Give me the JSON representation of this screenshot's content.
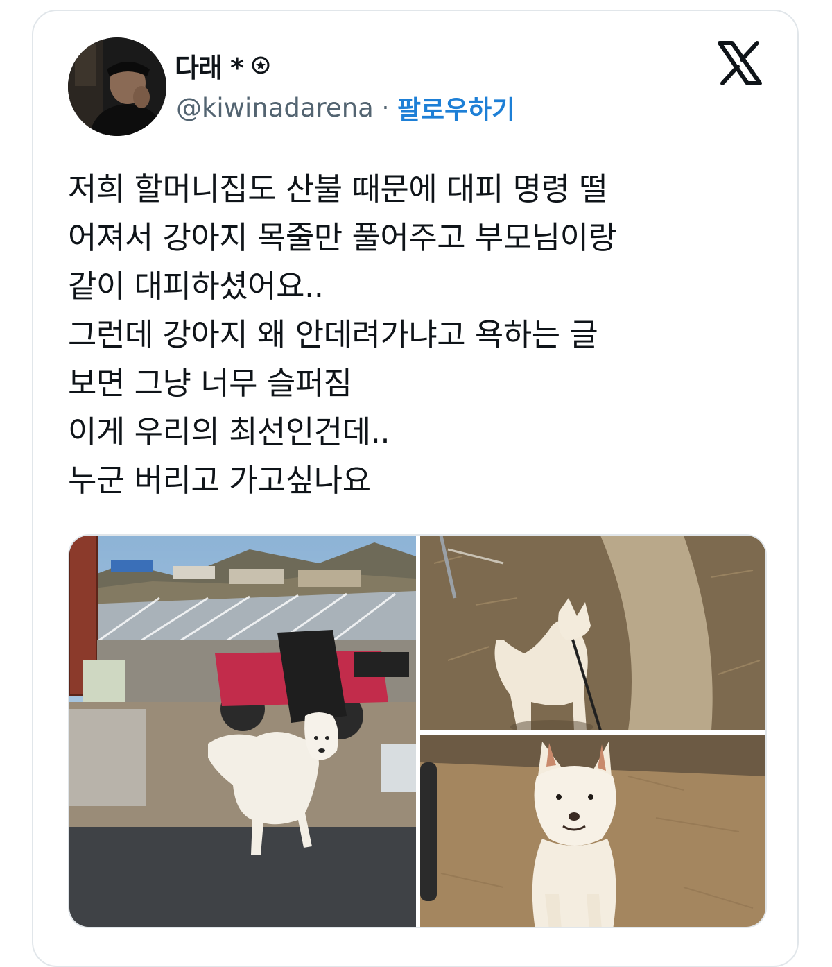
{
  "author": {
    "display_name": "다래 *",
    "badge_icon": "star-badge-icon",
    "handle": "@kiwinadarena",
    "separator": "·",
    "follow_label": "팔로우하기"
  },
  "platform_logo": "x-logo-icon",
  "tweet": {
    "lines": [
      "저희 할머니집도 산불 때문에 대피 명령 떨",
      "어져서 강아지 목줄만 풀어주고 부모님이랑",
      "같이 대피하셨어요..",
      "그런데 강아지 왜 안데려가냐고 욕하는 글",
      "보면 그냥 너무 슬퍼짐",
      "이게 우리의 최선인건데..",
      "누군 버리고 가고싶나요"
    ]
  },
  "media": {
    "photos": [
      {
        "subject": "white-dog-farmyard-photo"
      },
      {
        "subject": "white-dog-on-leash-photo"
      },
      {
        "subject": "white-dog-sitting-photo"
      }
    ]
  },
  "colors": {
    "text": "#0f1419",
    "secondary": "#536471",
    "link": "#1d7fd6",
    "border": "#e1e6ea"
  }
}
